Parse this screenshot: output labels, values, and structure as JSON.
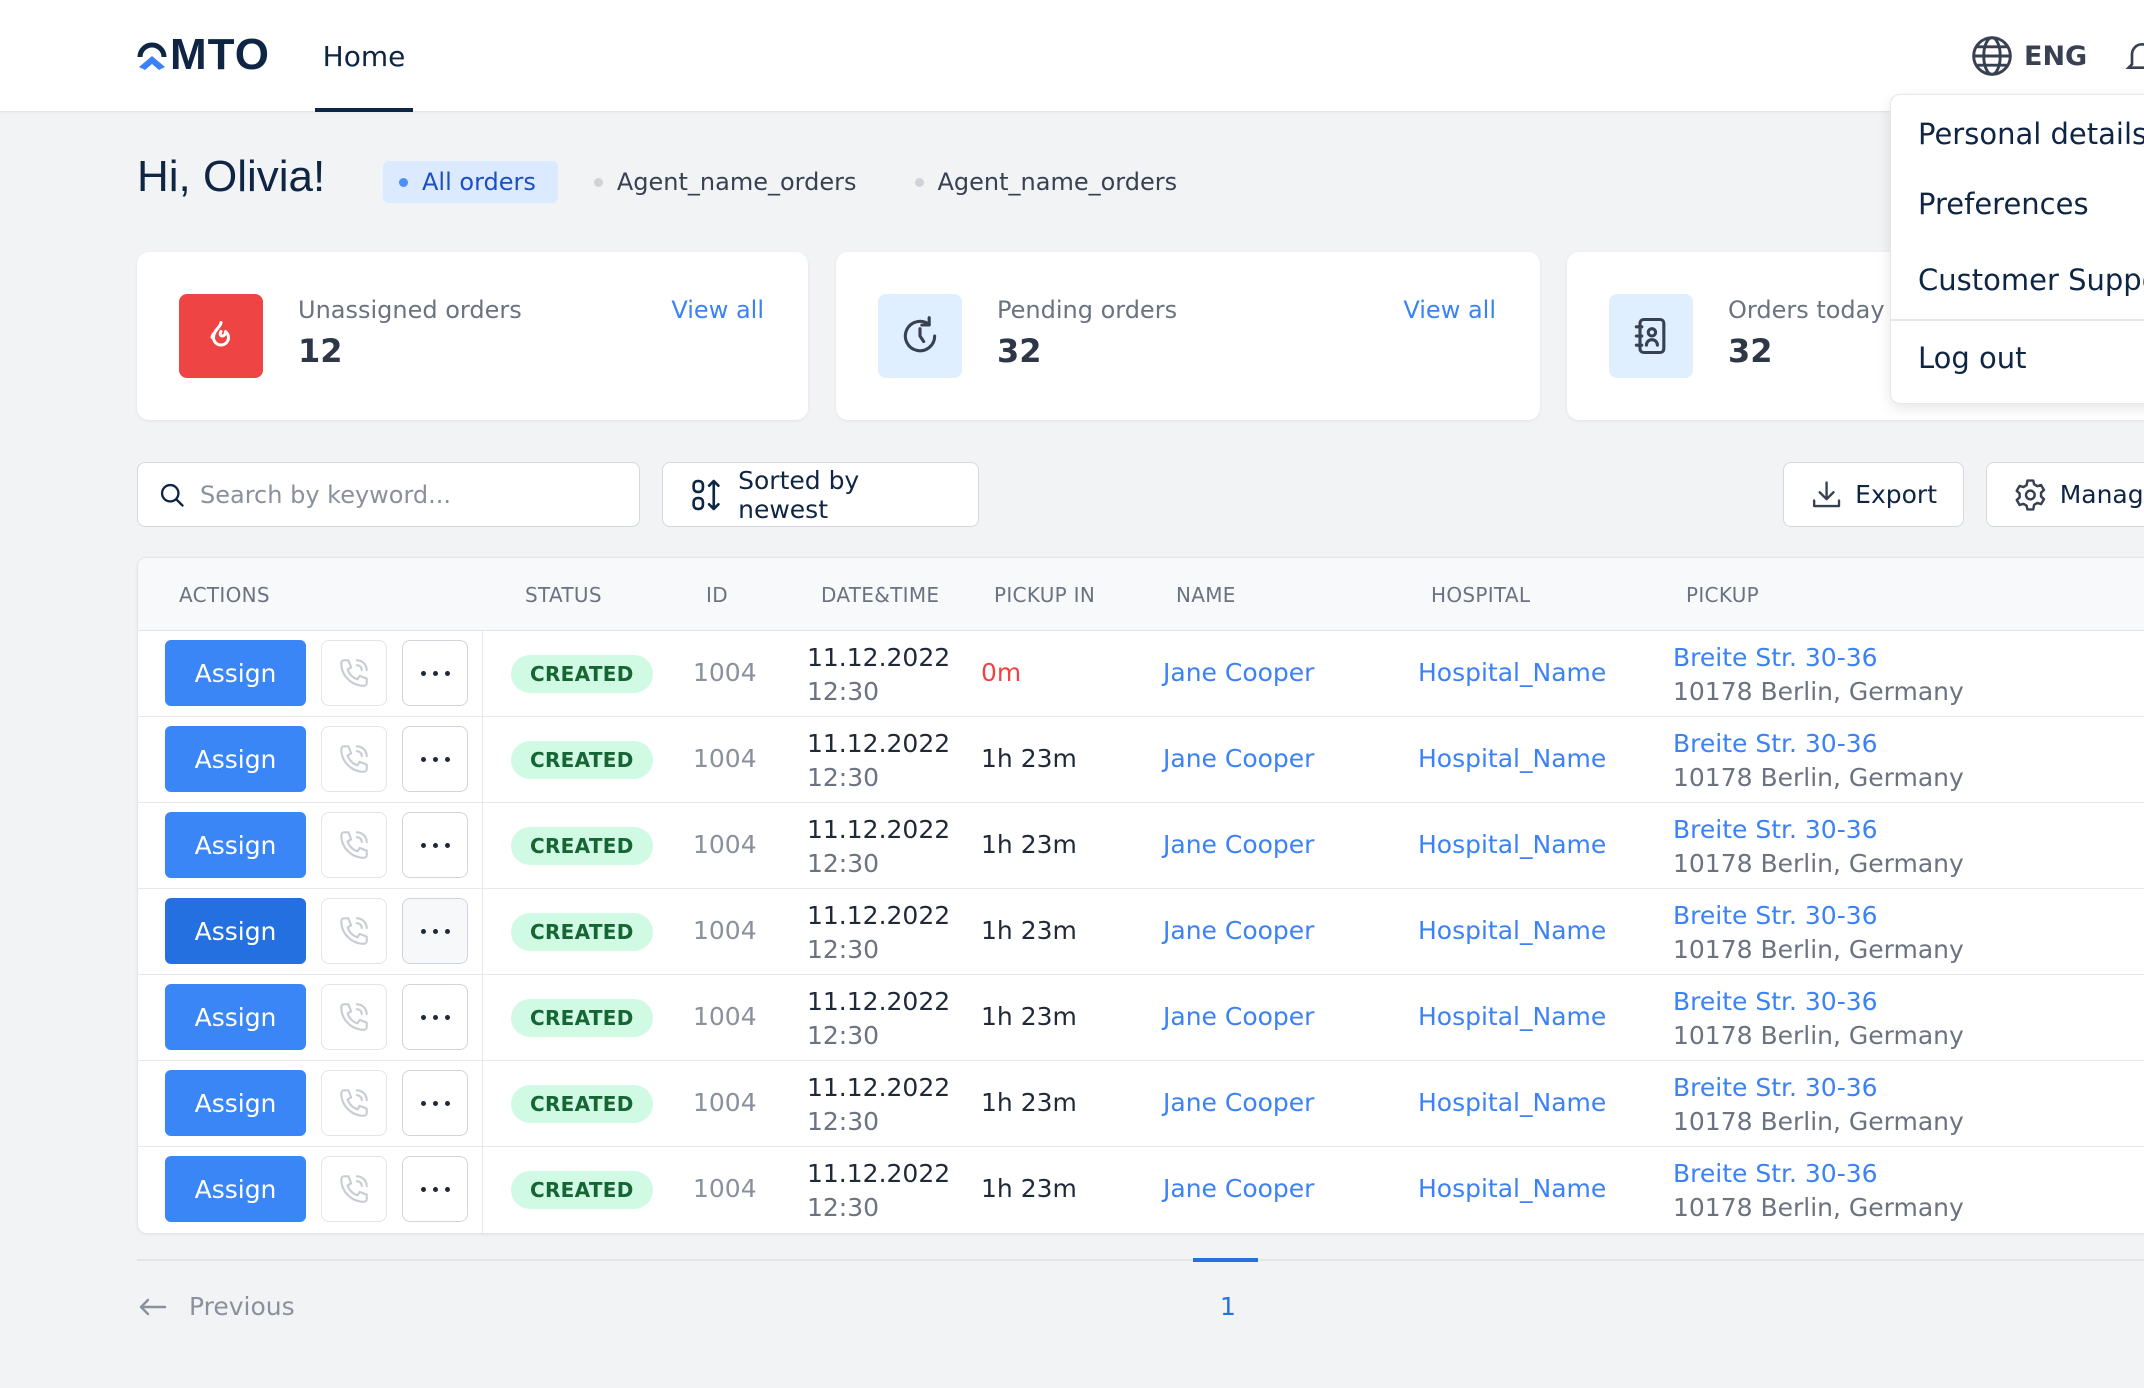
{
  "header": {
    "logo": "MTO",
    "nav": [
      {
        "label": "Home",
        "active": true
      }
    ],
    "language": "ENG"
  },
  "greeting": "Hi, Olivia!",
  "filter_tabs": [
    {
      "label": "All orders",
      "active": true
    },
    {
      "label": "Agent_name_orders",
      "active": false
    },
    {
      "label": "Agent_name_orders",
      "active": false
    }
  ],
  "summary_cards": [
    {
      "label": "Unassigned orders",
      "value": "12",
      "link": "View all",
      "icon": "fire-icon",
      "icon_bg": "#ef4444"
    },
    {
      "label": "Pending orders",
      "value": "32",
      "link": "View all",
      "icon": "clock-refresh-icon",
      "icon_bg": "#e0efff"
    },
    {
      "label": "Orders today",
      "value": "32",
      "icon": "contact-book-icon",
      "icon_bg": "#e0efff"
    }
  ],
  "toolbar": {
    "search_placeholder": "Search by keyword...",
    "sort_label": "Sorted by newest",
    "export_label": "Export",
    "manage_label": "Manage"
  },
  "table": {
    "columns": [
      "ACTIONS",
      "STATUS",
      "ID",
      "DATE&TIME",
      "PICKUP IN",
      "NAME",
      "HOSPITAL",
      "PICKUP"
    ],
    "assign_label": "Assign",
    "rows": [
      {
        "status": "CREATED",
        "id": "1004",
        "date": "11.12.2022",
        "time": "12:30",
        "pickup_in": "0m",
        "urgent": true,
        "name": "Jane Cooper",
        "hospital": "Hospital_Name",
        "street": "Breite Str. 30-36",
        "city": "10178 Berlin, Germany"
      },
      {
        "status": "CREATED",
        "id": "1004",
        "date": "11.12.2022",
        "time": "12:30",
        "pickup_in": "1h 23m",
        "urgent": false,
        "name": "Jane Cooper",
        "hospital": "Hospital_Name",
        "street": "Breite Str. 30-36",
        "city": "10178 Berlin, Germany"
      },
      {
        "status": "CREATED",
        "id": "1004",
        "date": "11.12.2022",
        "time": "12:30",
        "pickup_in": "1h 23m",
        "urgent": false,
        "name": "Jane Cooper",
        "hospital": "Hospital_Name",
        "street": "Breite Str. 30-36",
        "city": "10178 Berlin, Germany"
      },
      {
        "status": "CREATED",
        "id": "1004",
        "date": "11.12.2022",
        "time": "12:30",
        "pickup_in": "1h 23m",
        "urgent": false,
        "name": "Jane Cooper",
        "hospital": "Hospital_Name",
        "street": "Breite Str. 30-36",
        "city": "10178 Berlin, Germany"
      },
      {
        "status": "CREATED",
        "id": "1004",
        "date": "11.12.2022",
        "time": "12:30",
        "pickup_in": "1h 23m",
        "urgent": false,
        "name": "Jane Cooper",
        "hospital": "Hospital_Name",
        "street": "Breite Str. 30-36",
        "city": "10178 Berlin, Germany"
      },
      {
        "status": "CREATED",
        "id": "1004",
        "date": "11.12.2022",
        "time": "12:30",
        "pickup_in": "1h 23m",
        "urgent": false,
        "name": "Jane Cooper",
        "hospital": "Hospital_Name",
        "street": "Breite Str. 30-36",
        "city": "10178 Berlin, Germany"
      },
      {
        "status": "CREATED",
        "id": "1004",
        "date": "11.12.2022",
        "time": "12:30",
        "pickup_in": "1h 23m",
        "urgent": false,
        "name": "Jane Cooper",
        "hospital": "Hospital_Name",
        "street": "Breite Str. 30-36",
        "city": "10178 Berlin, Germany"
      }
    ]
  },
  "pagination": {
    "previous_label": "Previous",
    "current_page": "1"
  },
  "user_menu": {
    "items": [
      "Personal details",
      "Preferences",
      "Customer Support",
      "Log out"
    ]
  },
  "colors": {
    "primary": "#3a86f6",
    "primary_pressed": "#2470e0",
    "navy": "#0f2544",
    "danger": "#ef4444",
    "success_bg": "#d1fae5",
    "success_text": "#166534"
  }
}
